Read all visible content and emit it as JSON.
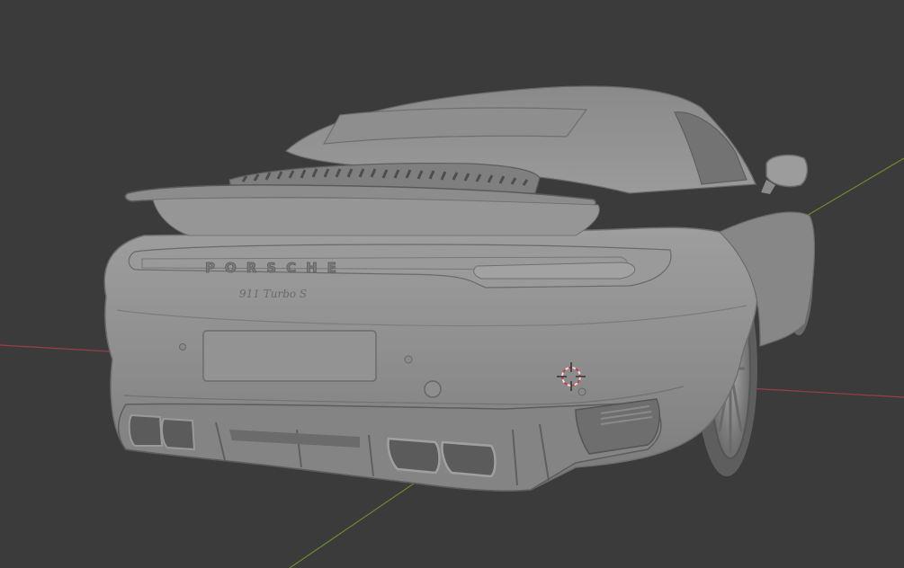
{
  "viewport": {
    "background": "#3b3b3b",
    "axis_x_color": "#9a3f45",
    "axis_y_color": "#6c8a2a",
    "model_color": "#9b9b9b",
    "cursor_colors": [
      "#e0e0e0",
      "#c94040"
    ]
  },
  "model": {
    "brand_lettering": "PORSCHE",
    "model_badge": "911 Turbo S"
  }
}
